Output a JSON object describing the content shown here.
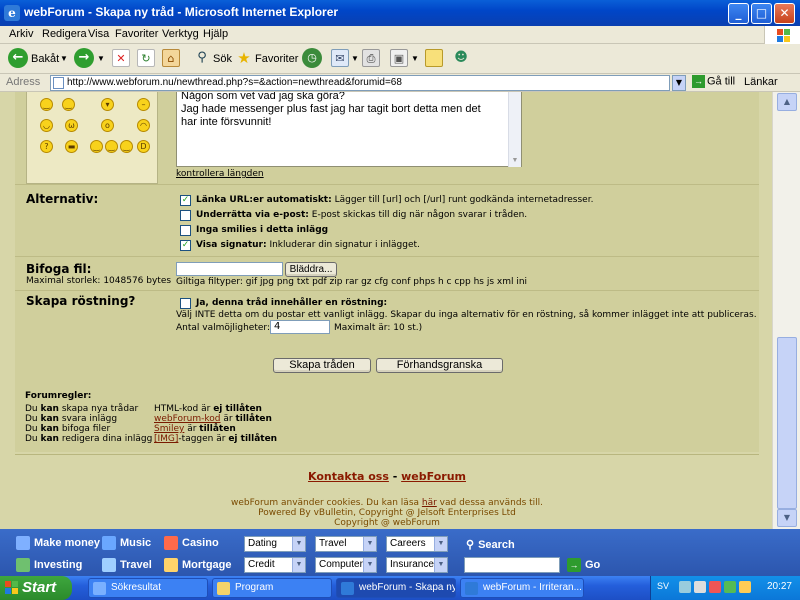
{
  "window": {
    "title": "webForum - Skapa ny tråd - Microsoft Internet Explorer",
    "controls": {
      "minimize": "_",
      "maximize": "□",
      "close": "✕"
    }
  },
  "menu": [
    "Arkiv",
    "Redigera",
    "Visa",
    "Favoriter",
    "Verktyg",
    "Hjälp"
  ],
  "toolbar": {
    "back_label": "Bakåt",
    "search_label": "Sök",
    "favorites_label": "Favoriter"
  },
  "address": {
    "label": "Adress",
    "url": "http://www.webforum.nu/newthread.php?s=&action=newthread&forumid=68",
    "go_label": "Gå till",
    "links_label": "Länkar"
  },
  "message": {
    "lines": [
      "Någon som vet vad jag ska göra?",
      "Jag hade messenger plus fast jag har tagit bort detta men det",
      "har inte försvunnit!"
    ],
    "check_length_link": "kontrollera längden"
  },
  "options": {
    "heading": "Alternativ:",
    "items": [
      {
        "checked": true,
        "title": "Länka URL:er automatiskt:",
        "desc": "Lägger till [url] och [/url] runt godkända internetadresser."
      },
      {
        "checked": false,
        "title": "Underrätta via e-post:",
        "desc": "E-post skickas till dig när någon svarar i tråden."
      },
      {
        "checked": false,
        "title": "Inga smilies i detta inlägg",
        "desc": ""
      },
      {
        "checked": true,
        "title": "Visa signatur:",
        "desc": "Inkluderar din signatur i inlägget."
      }
    ]
  },
  "attach": {
    "heading": "Bifoga fil:",
    "max_size": "Maximal storlek: 1048576 bytes",
    "browse_label": "Bläddra...",
    "filetypes": "Giltiga filtyper: gif jpg png txt pdf zip rar gz cfg conf phps h c cpp hs js xml ini"
  },
  "poll": {
    "heading": "Skapa röstning?",
    "checkbox_label": "Ja, denna tråd innehåller en röstning:",
    "desc": "Välj INTE detta om du postar ett vanligt inlägg. Skapar du inga alternativ för en röstning, så kommer inlägget inte att publiceras.",
    "count_label": "Antal valmöjligheter:",
    "count_value": "4",
    "max_label": "Maximalt är: 10 st.)"
  },
  "buttons": {
    "create": "Skapa tråden",
    "preview": "Förhandsgranska"
  },
  "rules": {
    "heading": "Forumregler:",
    "left": [
      [
        "Du ",
        "kan",
        " skapa nya trådar"
      ],
      [
        "Du ",
        "kan",
        " svara inlägg"
      ],
      [
        "Du ",
        "kan",
        " bifoga filer"
      ],
      [
        "Du ",
        "kan",
        " redigera dina inlägg"
      ]
    ],
    "right": [
      {
        "pre": "HTML-kod är ",
        "link": "",
        "bold": "ej tillåten"
      },
      {
        "pre": "",
        "link": "webForum-kod",
        "post": " är ",
        "bold": "tillåten"
      },
      {
        "pre": "",
        "link": "Smiley",
        "post": " är ",
        "bold": "tillåten"
      },
      {
        "pre": "",
        "link": "[IMG]",
        "post": "-taggen är ",
        "bold": "ej tillåten"
      }
    ]
  },
  "footer": {
    "contact": "Kontakta oss",
    "dash": " - ",
    "site": "webForum",
    "cookies_pre": "webForum använder cookies. Du kan läsa ",
    "cookies_link": "här",
    "cookies_post": " vad dessa används till.",
    "powered": "Powered By vBulletin, Copyright @ Jelsoft Enterprises Ltd",
    "copyright": "Copyright @ webForum"
  },
  "adbar": {
    "links": [
      "Make money",
      "Music",
      "Casino",
      "Investing",
      "Travel",
      "Mortgage"
    ],
    "selects_row1": [
      "Dating",
      "Travel",
      "Careers"
    ],
    "selects_row2": [
      "Credit",
      "Computers",
      "Insurance"
    ],
    "search_label": "Search",
    "go_label": "Go"
  },
  "taskbar": {
    "start_label": "Start",
    "tasks": [
      "Sökresultat",
      "Program",
      "webForum - Skapa ny...",
      "webForum - Irriteran..."
    ],
    "lang": "SV",
    "clock": "20:27"
  }
}
